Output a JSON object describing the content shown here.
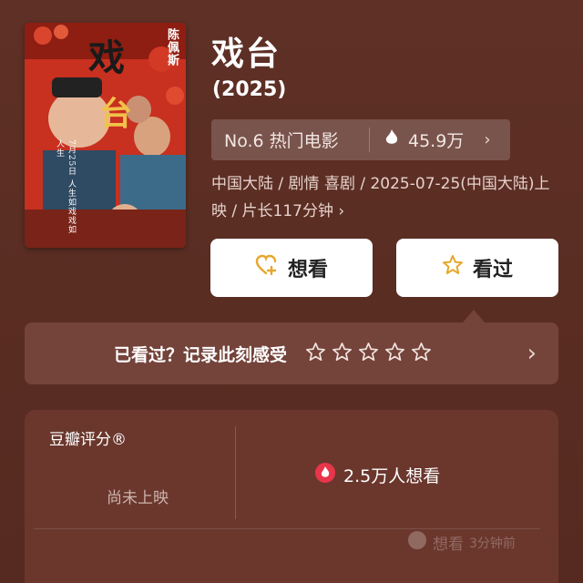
{
  "movie": {
    "title": "戏台",
    "year": "(2025)",
    "rank": "No.6 热门电影",
    "heat": "45.9万",
    "meta": "中国大陆 / 剧情 喜剧 / 2025-07-25(中国大陆)上映 / 片长117分钟 ›"
  },
  "poster": {
    "actor": "陈佩斯",
    "title_chars": "戏台",
    "tagline": "7月25日 人生如戏戏如人生"
  },
  "actions": {
    "want_label": "想看",
    "seen_label": "看过"
  },
  "record": {
    "prompt": "已看过？记录此刻感受",
    "stars": 5
  },
  "rating": {
    "label": "豆瓣评分®",
    "status": "尚未上映",
    "wish": "2.5万人想看"
  },
  "watermark": {
    "text": "想看",
    "time": "3分钟前"
  },
  "colors": {
    "background": "#5b2e24",
    "card": "#6b372d",
    "bar": "#74433a",
    "accent_star": "#e5a72a",
    "heat_red": "#e8354a"
  }
}
